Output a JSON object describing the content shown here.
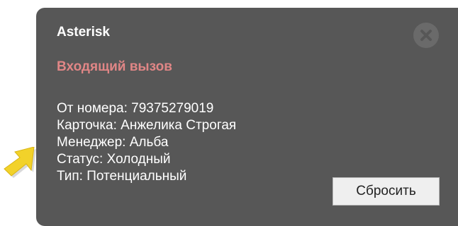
{
  "popup": {
    "title": "Asterisk",
    "subtitle": "Входящий вызов",
    "details": [
      "От номера: 79375279019",
      "Карточка: Анжелика Строгая",
      "Менеджер: Альба",
      "Статус: Холодный",
      "Тип: Потенциальный"
    ],
    "reset_label": "Сбросить",
    "close_icon": "close-circle-icon"
  },
  "pointer": {
    "icon": "arrow-pointer-icon",
    "color": "#f2d22a"
  },
  "colors": {
    "popup_background": "#575757",
    "subtitle": "#e08686",
    "text": "#ffffff",
    "button_background": "#efefef"
  }
}
